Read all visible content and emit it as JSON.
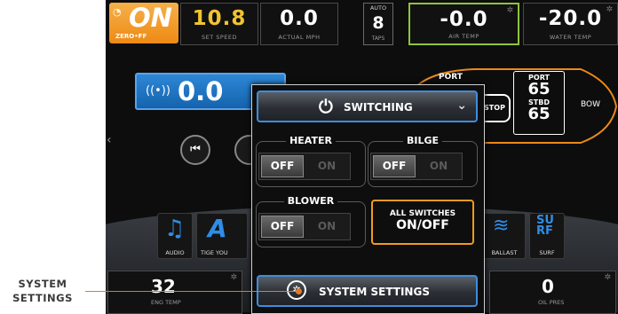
{
  "callout": {
    "line1": "SYSTEM",
    "line2": "SETTINGS"
  },
  "top_bar": {
    "zero_off": {
      "state": "ON",
      "label": "ZERO•FF"
    },
    "set_speed": {
      "value": "10.8",
      "label": "SET SPEED"
    },
    "actual_mph": {
      "value": "0.0",
      "label": "ACTUAL MPH"
    },
    "taps": {
      "badge": "AUTO",
      "value": "8",
      "label": "TAPS"
    },
    "air_temp": {
      "value": "-0.0",
      "label": "AIR TEMP"
    },
    "water_temp": {
      "value": "-20.0",
      "label": "WATER TEMP"
    }
  },
  "audio_widget": {
    "value": "0.0"
  },
  "boat_diagram": {
    "port_label": "PORT",
    "port_value": "65",
    "stbd_label": "STBD",
    "stbd_value": "65",
    "stop_label": "STOP",
    "bow_label": "BOW",
    "left_port_label": "PORT"
  },
  "switching_panel": {
    "header": "SWITCHING",
    "heater": {
      "title": "HEATER",
      "off": "OFF",
      "on": "ON"
    },
    "bilge": {
      "title": "BILGE",
      "off": "OFF",
      "on": "ON"
    },
    "blower": {
      "title": "BLOWER",
      "off": "OFF",
      "on": "ON"
    },
    "all_switches": {
      "line1": "ALL SWITCHES",
      "line2": "ON/OFF"
    },
    "system_settings": "SYSTEM SETTINGS"
  },
  "apps": [
    {
      "label": "AUDIO",
      "icon": "music-note-icon"
    },
    {
      "label": "TIGE YOU",
      "icon": "tige-logo-icon"
    },
    {
      "label": "BALLAST",
      "icon": "ballast-icon"
    },
    {
      "label": "SURF",
      "icon": "surf-icon"
    }
  ],
  "bottom_bar": {
    "eng_temp": {
      "value": "32",
      "label": "ENG TEMP"
    },
    "oil_pres": {
      "value": "0",
      "label": "OIL PRES"
    }
  },
  "colors": {
    "accent_blue": "#3b8de0",
    "orange": "#f39a1e",
    "green_border": "#8fc43c",
    "set_speed_yellow": "#f2c330"
  }
}
